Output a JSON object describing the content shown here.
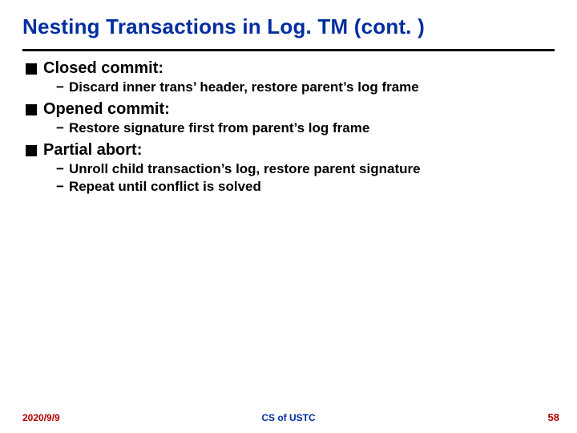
{
  "title": "Nesting Transactions in Log. TM (cont. )",
  "sections": [
    {
      "heading": "Closed commit:",
      "points": [
        "Discard inner trans’ header, restore parent’s log frame"
      ]
    },
    {
      "heading": "Opened commit:",
      "points": [
        "Restore signature first from parent’s log frame"
      ]
    },
    {
      "heading": "Partial abort:",
      "points": [
        "Unroll child transaction’s log, restore parent signature",
        "Repeat until conflict is solved"
      ]
    }
  ],
  "footer": {
    "date": "2020/9/9",
    "affiliation": "CS of USTC",
    "page": "58"
  },
  "bullets": {
    "dash": "−"
  }
}
